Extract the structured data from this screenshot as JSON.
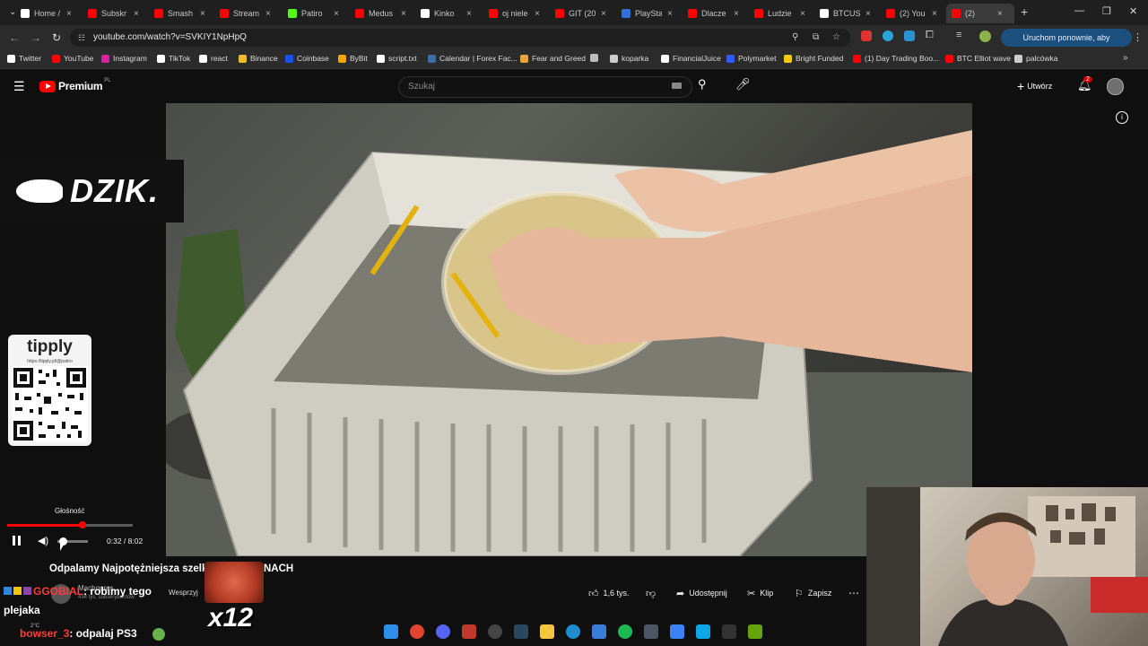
{
  "tabs": [
    {
      "label": "Home /",
      "icon": "x-icon",
      "color": "#ffffff"
    },
    {
      "label": "Subskr",
      "icon": "youtube-icon",
      "color": "#ff0000"
    },
    {
      "label": "Smash",
      "icon": "youtube-icon",
      "color": "#ff0000"
    },
    {
      "label": "Stream",
      "icon": "youtube-icon",
      "color": "#ff0000"
    },
    {
      "label": "Patiro",
      "icon": "kick-icon",
      "color": "#53fc18"
    },
    {
      "label": "Medus",
      "icon": "youtube-icon",
      "color": "#ff0000"
    },
    {
      "label": "Kinko",
      "icon": "grid-icon",
      "color": "#ffffff"
    },
    {
      "label": "oj niele",
      "icon": "youtube-icon",
      "color": "#ff0000"
    },
    {
      "label": "GIT (20",
      "icon": "youtube-icon",
      "color": "#ff0000"
    },
    {
      "label": "PlaySta",
      "icon": "playstation-icon",
      "color": "#2f6fd8"
    },
    {
      "label": "Dlacze",
      "icon": "youtube-icon",
      "color": "#ff0000"
    },
    {
      "label": "Ludzie",
      "icon": "youtube-icon",
      "color": "#ff0000"
    },
    {
      "label": "BTCUS",
      "icon": "tradingview-icon",
      "color": "#ffffff"
    },
    {
      "label": "(2) You",
      "icon": "youtube-icon",
      "color": "#ff0000"
    },
    {
      "label": "(2)",
      "icon": "youtube-icon",
      "color": "#ff0000"
    }
  ],
  "new_tab": "+",
  "window": {
    "minimize": "—",
    "restore": "❐",
    "close": "✕"
  },
  "address": {
    "url": "youtube.com/watch?v=SVKIY1NpHpQ"
  },
  "update_button": "Uruchom ponownie, aby zaktualizować",
  "bookmarks": [
    {
      "label": "Twitter",
      "color": "#ffffff"
    },
    {
      "label": "YouTube",
      "color": "#ff0000"
    },
    {
      "label": "Instagram",
      "color": "#d6249f"
    },
    {
      "label": "TikTok",
      "color": "#ffffff"
    },
    {
      "label": "react",
      "color": "#ffffff"
    },
    {
      "label": "Binance",
      "color": "#f3ba2f"
    },
    {
      "label": "Coinbase",
      "color": "#1652f0"
    },
    {
      "label": "ByBit",
      "color": "#f7a600"
    },
    {
      "label": "script.txt",
      "color": "#ffffff"
    },
    {
      "label": "Calendar | Forex Fac...",
      "color": "#3a6ea5"
    },
    {
      "label": "Fear and Greed",
      "color": "#e8a33d"
    },
    {
      "label": "",
      "color": "#bbbbbb"
    },
    {
      "label": "koparka",
      "color": "#cccccc"
    },
    {
      "label": "FinancialJuice",
      "color": "#ffffff"
    },
    {
      "label": "Polymarket",
      "color": "#2e5cff"
    },
    {
      "label": "Bright Funded",
      "color": "#f2c811"
    },
    {
      "label": "(1) Day Trading Boo...",
      "color": "#ff0000"
    },
    {
      "label": "BTC Elliot wave",
      "color": "#ff0000"
    },
    {
      "label": "palcówka",
      "color": "#cccccc"
    }
  ],
  "youtube": {
    "logo": "Premium",
    "logo_suffix": "PL",
    "search_placeholder": "Szukaj",
    "create_label": "Utwórz",
    "notification_count": "2"
  },
  "overlays": {
    "dzik_logo": "DZIK.",
    "tipply_title": "tipply",
    "tipply_url": "https://tipply.pl/@patiro"
  },
  "player": {
    "volume_tooltip": "Głośność",
    "time": "0:32 / 8:02",
    "progress": 0.066
  },
  "video_info": {
    "title_start": "Odpalamy Najpotężniejsza szelk",
    "title_end": "NACH",
    "channel": "Machopres...",
    "subscribers": "434 tys. subskrybentów",
    "support": "Wesprzyj",
    "multiplier": "x12",
    "likes": "1,6 tys.",
    "share": "Udostępnij",
    "clip": "Klip",
    "save": "Zapisz",
    "more": "⋯"
  },
  "chat": [
    {
      "user": "GGOBIAL",
      "text": ": robimy tego",
      "user_color": "#ff3b3b"
    },
    {
      "user": "",
      "text": "plejaka",
      "user_color": "#ffffff"
    },
    {
      "user": "bowser_3",
      "text": ": odpalaj PS3",
      "user_color": "#ff3b3b"
    }
  ],
  "weather": "2°C"
}
